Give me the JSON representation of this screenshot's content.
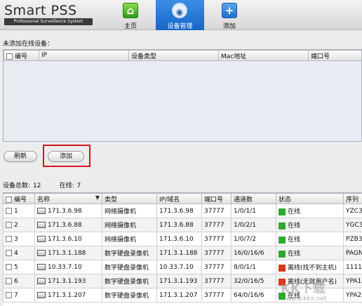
{
  "app": {
    "title": "Smart PSS",
    "subtitle": "Professional Surveillance System"
  },
  "nav": {
    "home": "主页",
    "device_manager": "设备管理",
    "add": "添加"
  },
  "unadded": {
    "label": "未添加在线设备：",
    "columns": [
      "编号",
      "IP",
      "设备类型",
      "Mac地址",
      "端口号"
    ]
  },
  "buttons": {
    "refresh": "刷新",
    "add": "添加"
  },
  "counts": {
    "total_label": "设备总数:",
    "total_value": "12",
    "online_label": "在线:",
    "online_value": "7"
  },
  "devices": {
    "columns": [
      "编号",
      "名称",
      "类型",
      "IP/域名",
      "端口号",
      "通道数",
      "状态",
      "序列"
    ],
    "rows": [
      {
        "no": "1",
        "name": "171.3.6.98",
        "type": "网络摄像机",
        "ip": "171.3.6.98",
        "port": "37777",
        "channels": "1/0/1/1",
        "status": "在线",
        "status_color": "#2fa82f",
        "serial": "YZC3"
      },
      {
        "no": "2",
        "name": "171.3.6.88",
        "type": "网络摄像机",
        "ip": "171.3.6.88",
        "port": "37777",
        "channels": "1/0/2/1",
        "status": "在线",
        "status_color": "#2fa82f",
        "serial": "YGC3"
      },
      {
        "no": "3",
        "name": "171.3.6.10",
        "type": "网络摄像机",
        "ip": "171.3.6.10",
        "port": "37777",
        "channels": "1/0/7/2",
        "status": "在线",
        "status_color": "#2fa82f",
        "serial": "PZB3"
      },
      {
        "no": "4",
        "name": "171.3.1.188",
        "type": "数字硬盘录像机",
        "ip": "171.3.1.188",
        "port": "37777",
        "channels": "16/0/16/6",
        "status": "在线",
        "status_color": "#2fa82f",
        "serial": "PAGN"
      },
      {
        "no": "5",
        "name": "10.33.7.10",
        "type": "数字硬盘录像机",
        "ip": "10.33.7.10",
        "port": "37777",
        "channels": "8/0/1/1",
        "status": "离线(找不到主机)",
        "status_color": "#d93a1a",
        "serial": "1111"
      },
      {
        "no": "6",
        "name": "171.3.1.193",
        "type": "数字硬盘录像机",
        "ip": "171.3.1.193",
        "port": "37777",
        "channels": "32/0/16/5",
        "status": "离线(无效用户名)",
        "status_color": "#d93a1a",
        "serial": "YPA1"
      },
      {
        "no": "7",
        "name": "171.3.1.207",
        "type": "数字硬盘录像机",
        "ip": "171.3.1.207",
        "port": "37777",
        "channels": "64/0/16/6",
        "status": "在线",
        "status_color": "#2fa82f",
        "serial": "YPA2"
      }
    ]
  },
  "watermark": {
    "main": "KK下载",
    "url": "www.kkx.net"
  }
}
